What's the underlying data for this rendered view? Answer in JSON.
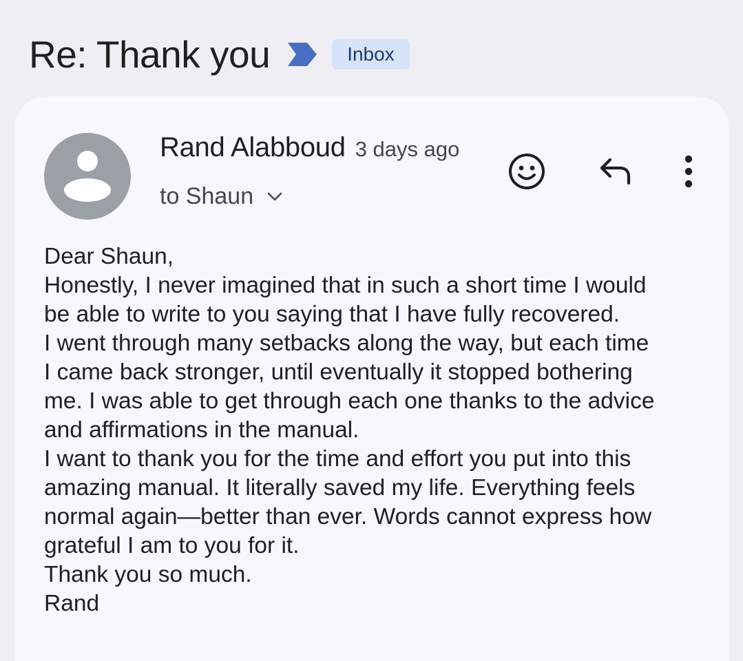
{
  "header": {
    "subject": "Re: Thank you",
    "label": "Inbox",
    "important_marker_color": "#4a6ec2"
  },
  "message": {
    "sender_name": "Rand Alabboud",
    "sent_time": "3 days ago",
    "recipient": "to Shaun",
    "avatar_color": "#9aa0a6",
    "icons": {
      "emoji": "add-reaction-icon",
      "reply": "reply-icon",
      "more": "more-vert-icon",
      "details": "chevron-down-icon"
    },
    "body_lines": [
      "Dear Shaun,",
      "Honestly, I never imagined that in such a short time I would",
      "be able to write to you saying that I have fully recovered.",
      "I went through many setbacks along the way, but each time",
      "I came back stronger, until eventually it stopped bothering",
      "me. I was able to get through each one thanks to the advice",
      "and affirmations in the manual.",
      "I want to thank you for the time and effort you put into this",
      "amazing manual. It literally saved my life. Everything feels",
      "normal again—better than ever. Words cannot express how",
      "grateful I am to you for it.",
      "Thank you so much.",
      "Rand"
    ]
  }
}
